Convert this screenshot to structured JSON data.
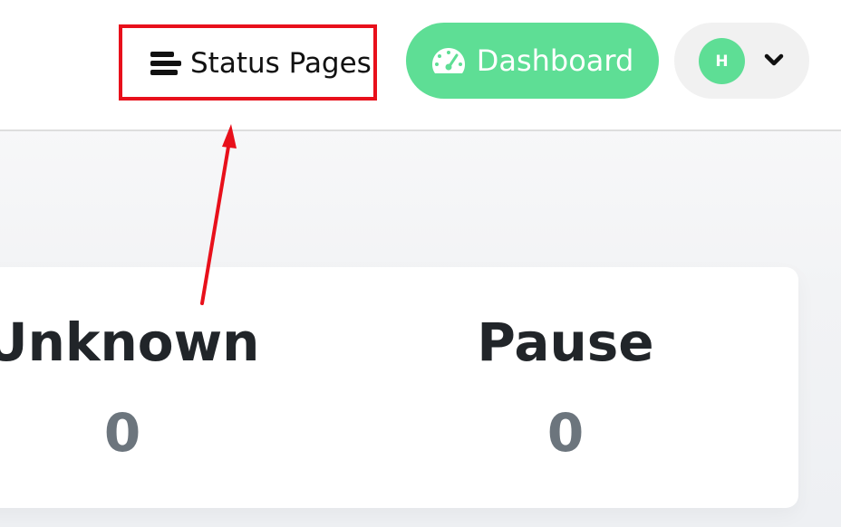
{
  "header": {
    "status_pages_label": "Status Pages",
    "dashboard_label": "Dashboard",
    "avatar_initial": "H"
  },
  "stats": {
    "unknown": {
      "label": "Unknown",
      "value": "0"
    },
    "pause": {
      "label": "Pause",
      "value": "0"
    }
  },
  "annotation": {
    "color": "#e8101b"
  },
  "colors": {
    "accent": "#5ede95",
    "stat_value": "#6c757d"
  },
  "icons": {
    "status_pages": "list-icon",
    "dashboard": "speedometer-icon",
    "dropdown": "chevron-down-icon"
  }
}
